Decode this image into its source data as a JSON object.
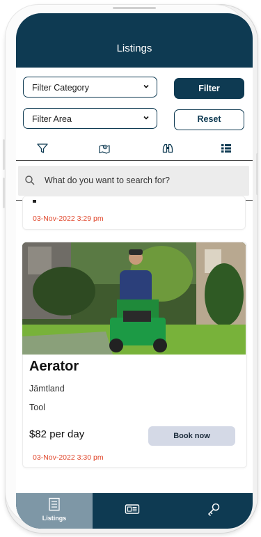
{
  "header": {
    "title": "Listings"
  },
  "filters": {
    "category_label": "Filter Category",
    "area_label": "Filter Area",
    "filter_button": "Filter",
    "reset_button": "Reset"
  },
  "view_icons": [
    "filter-icon",
    "map-icon",
    "binoculars-icon",
    "list-icon"
  ],
  "search": {
    "placeholder": "What do you want to search for?"
  },
  "listings": [
    {
      "date": "03-Nov-2022 3:29 pm"
    },
    {
      "title": "Aerator",
      "location": "Jämtland",
      "category": "Tool",
      "price": "$82 per day",
      "book_label": "Book now",
      "date": "03-Nov-2022 3:30 pm"
    }
  ],
  "bottom_nav": {
    "items": [
      {
        "icon": "listings-icon",
        "label": "Listings",
        "active": true
      },
      {
        "icon": "id-card-icon",
        "label": ""
      },
      {
        "icon": "key-icon",
        "label": ""
      }
    ]
  },
  "colors": {
    "primary": "#0e3a52",
    "accent_date": "#e0462b",
    "button_secondary": "#d4d9e6",
    "nav_active": "#7e97a6"
  }
}
